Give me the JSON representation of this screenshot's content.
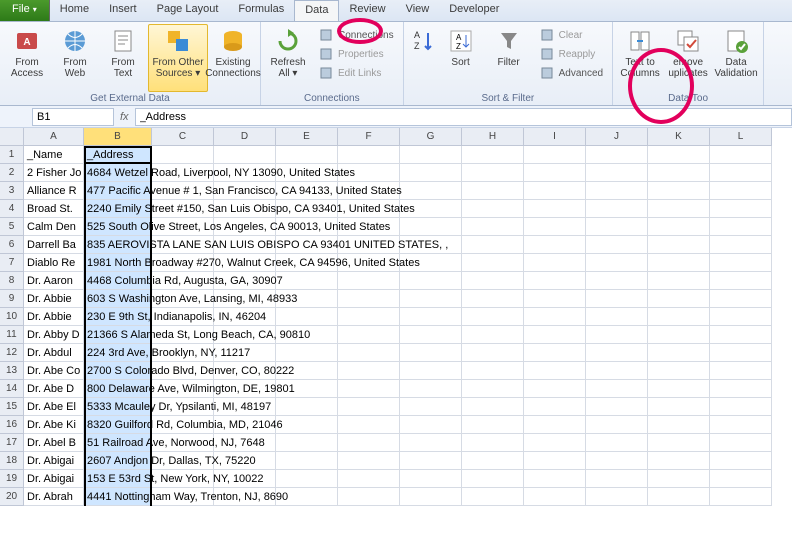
{
  "tabs": [
    "File",
    "Home",
    "Insert",
    "Page Layout",
    "Formulas",
    "Data",
    "Review",
    "View",
    "Developer"
  ],
  "active_tab_index": 5,
  "ribbon": {
    "groups": [
      {
        "label": "Get External Data",
        "large": [
          {
            "name": "from-access",
            "label": "From Access"
          },
          {
            "name": "from-web",
            "label": "From Web"
          },
          {
            "name": "from-text",
            "label": "From Text"
          },
          {
            "name": "from-other-sources",
            "label": "From Other Sources ▾",
            "sel": true
          },
          {
            "name": "existing-connections",
            "label": "Existing Connections"
          }
        ]
      },
      {
        "label": "Connections",
        "large": [
          {
            "name": "refresh-all",
            "label": "Refresh All ▾"
          }
        ],
        "small": [
          {
            "name": "connections",
            "label": "Connections"
          },
          {
            "name": "properties",
            "label": "Properties",
            "disabled": true
          },
          {
            "name": "edit-links",
            "label": "Edit Links",
            "disabled": true
          }
        ]
      },
      {
        "label": "Sort & Filter",
        "large": [
          {
            "name": "sort-az",
            "label": ""
          },
          {
            "name": "sort",
            "label": "Sort"
          },
          {
            "name": "filter",
            "label": "Filter"
          }
        ],
        "small": [
          {
            "name": "clear",
            "label": "Clear",
            "disabled": true
          },
          {
            "name": "reapply",
            "label": "Reapply",
            "disabled": true
          },
          {
            "name": "advanced",
            "label": "Advanced"
          }
        ]
      },
      {
        "label": "Data Too",
        "large": [
          {
            "name": "text-to-columns",
            "label": "Text to Columns"
          },
          {
            "name": "remove-duplicates",
            "label": "emove uplicates"
          },
          {
            "name": "data-validation",
            "label": "Data Validation"
          }
        ]
      }
    ]
  },
  "namebox": "B1",
  "formula": "_Address",
  "columns": [
    "A",
    "B",
    "C",
    "D",
    "E",
    "F",
    "G",
    "H",
    "I",
    "J",
    "K",
    "L"
  ],
  "selected_col_index": 1,
  "rows": [
    {
      "n": 1,
      "a": "_Name",
      "b": "_Address"
    },
    {
      "n": 2,
      "a": "2 Fisher Jo",
      "b": "4684 Wetzel Road, Liverpool, NY 13090, United States"
    },
    {
      "n": 3,
      "a": "Alliance R",
      "b": "477 Pacific Avenue # 1, San Francisco, CA 94133, United States"
    },
    {
      "n": 4,
      "a": "Broad St. ",
      "b": "2240 Emily Street #150, San Luis Obispo, CA 93401, United States"
    },
    {
      "n": 5,
      "a": "Calm Den",
      "b": "525 South Olive Street, Los Angeles, CA 90013, United States"
    },
    {
      "n": 6,
      "a": "Darrell Ba",
      "b": "835 AEROVISTA LANE  SAN LUIS OBISPO  CA 93401  UNITED STATES, ,"
    },
    {
      "n": 7,
      "a": "Diablo Re",
      "b": "1981 North Broadway #270, Walnut Creek, CA 94596, United States"
    },
    {
      "n": 8,
      "a": "Dr. Aaron",
      "b": "4468 Columbia Rd, Augusta, GA, 30907"
    },
    {
      "n": 9,
      "a": "Dr. Abbie",
      "b": "603 S Washington Ave, Lansing, MI, 48933"
    },
    {
      "n": 10,
      "a": "Dr. Abbie",
      "b": "230 E 9th St, Indianapolis, IN, 46204"
    },
    {
      "n": 11,
      "a": "Dr. Abby D",
      "b": "21366 S Alameda St, Long Beach, CA, 90810"
    },
    {
      "n": 12,
      "a": "Dr. Abdul",
      "b": "224 3rd Ave, Brooklyn, NY, 11217"
    },
    {
      "n": 13,
      "a": "Dr. Abe Co",
      "b": "2700 S Colorado Blvd, Denver, CO, 80222"
    },
    {
      "n": 14,
      "a": "Dr. Abe D",
      "b": "800 Delaware Ave, Wilmington, DE, 19801"
    },
    {
      "n": 15,
      "a": "Dr. Abe El",
      "b": "5333 Mcauley Dr, Ypsilanti, MI, 48197"
    },
    {
      "n": 16,
      "a": "Dr. Abe Ki",
      "b": "8320 Guilford Rd, Columbia, MD, 21046"
    },
    {
      "n": 17,
      "a": "Dr. Abel B",
      "b": "51 Railroad Ave, Norwood, NJ, 7648"
    },
    {
      "n": 18,
      "a": "Dr. Abigai",
      "b": "2607 Andjon Dr, Dallas, TX, 75220"
    },
    {
      "n": 19,
      "a": "Dr. Abigai",
      "b": "153 E 53rd St, New York, NY, 10022"
    },
    {
      "n": 20,
      "a": "Dr. Abrah",
      "b": "4441 Nottingham Way, Trenton, NJ, 8690"
    }
  ]
}
